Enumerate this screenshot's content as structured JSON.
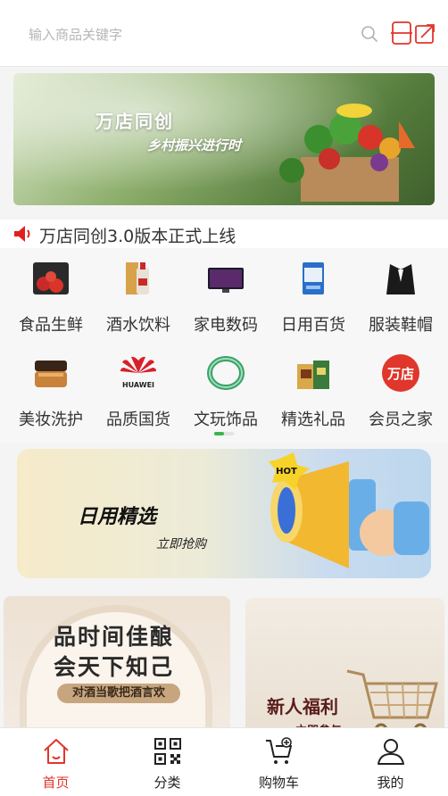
{
  "search": {
    "placeholder": "输入商品关键字",
    "icons": [
      "search-icon",
      "scan-icon"
    ]
  },
  "banner": {
    "title": "万店同创",
    "subtitle": "乡村振兴进行时",
    "slide_count": 2,
    "active_slide": 1
  },
  "notice": {
    "text": "万店同创3.0版本正式上线",
    "icon": "speaker-icon",
    "color": "#e02020"
  },
  "categories": [
    {
      "label": "食品生鲜",
      "icon": "apple-box-icon"
    },
    {
      "label": "酒水饮料",
      "icon": "liquor-bottle-icon"
    },
    {
      "label": "家电数码",
      "icon": "tv-icon"
    },
    {
      "label": "日用百货",
      "icon": "tissue-box-icon"
    },
    {
      "label": "服装鞋帽",
      "icon": "suit-icon"
    },
    {
      "label": "美妆洗护",
      "icon": "cosmetic-jar-icon"
    },
    {
      "label": "品质国货",
      "icon": "huawei-logo-icon",
      "logo_text": "HUAWEI"
    },
    {
      "label": "文玩饰品",
      "icon": "jade-bracelet-icon"
    },
    {
      "label": "精选礼品",
      "icon": "gift-box-icon"
    },
    {
      "label": "会员之家",
      "icon": "wandian-badge-icon",
      "badge_text": "万店"
    }
  ],
  "promo": {
    "title": "日用精选",
    "subtitle": "立即抢购",
    "badge": "HOT"
  },
  "cards": {
    "left": {
      "line1": "品时间佳酿",
      "line2": "会天下知己",
      "line3": "对酒当歌把酒言欢"
    },
    "right": {
      "title": "新人福利",
      "subtitle": "立即参与"
    }
  },
  "tabbar": [
    {
      "label": "首页",
      "icon": "home-icon",
      "active": true
    },
    {
      "label": "分类",
      "icon": "qr-code-icon",
      "active": false
    },
    {
      "label": "购物车",
      "icon": "cart-icon",
      "active": false
    },
    {
      "label": "我的",
      "icon": "user-icon",
      "active": false
    }
  ],
  "colors": {
    "accent": "#e0362b",
    "indicator": "#3bb54a"
  }
}
